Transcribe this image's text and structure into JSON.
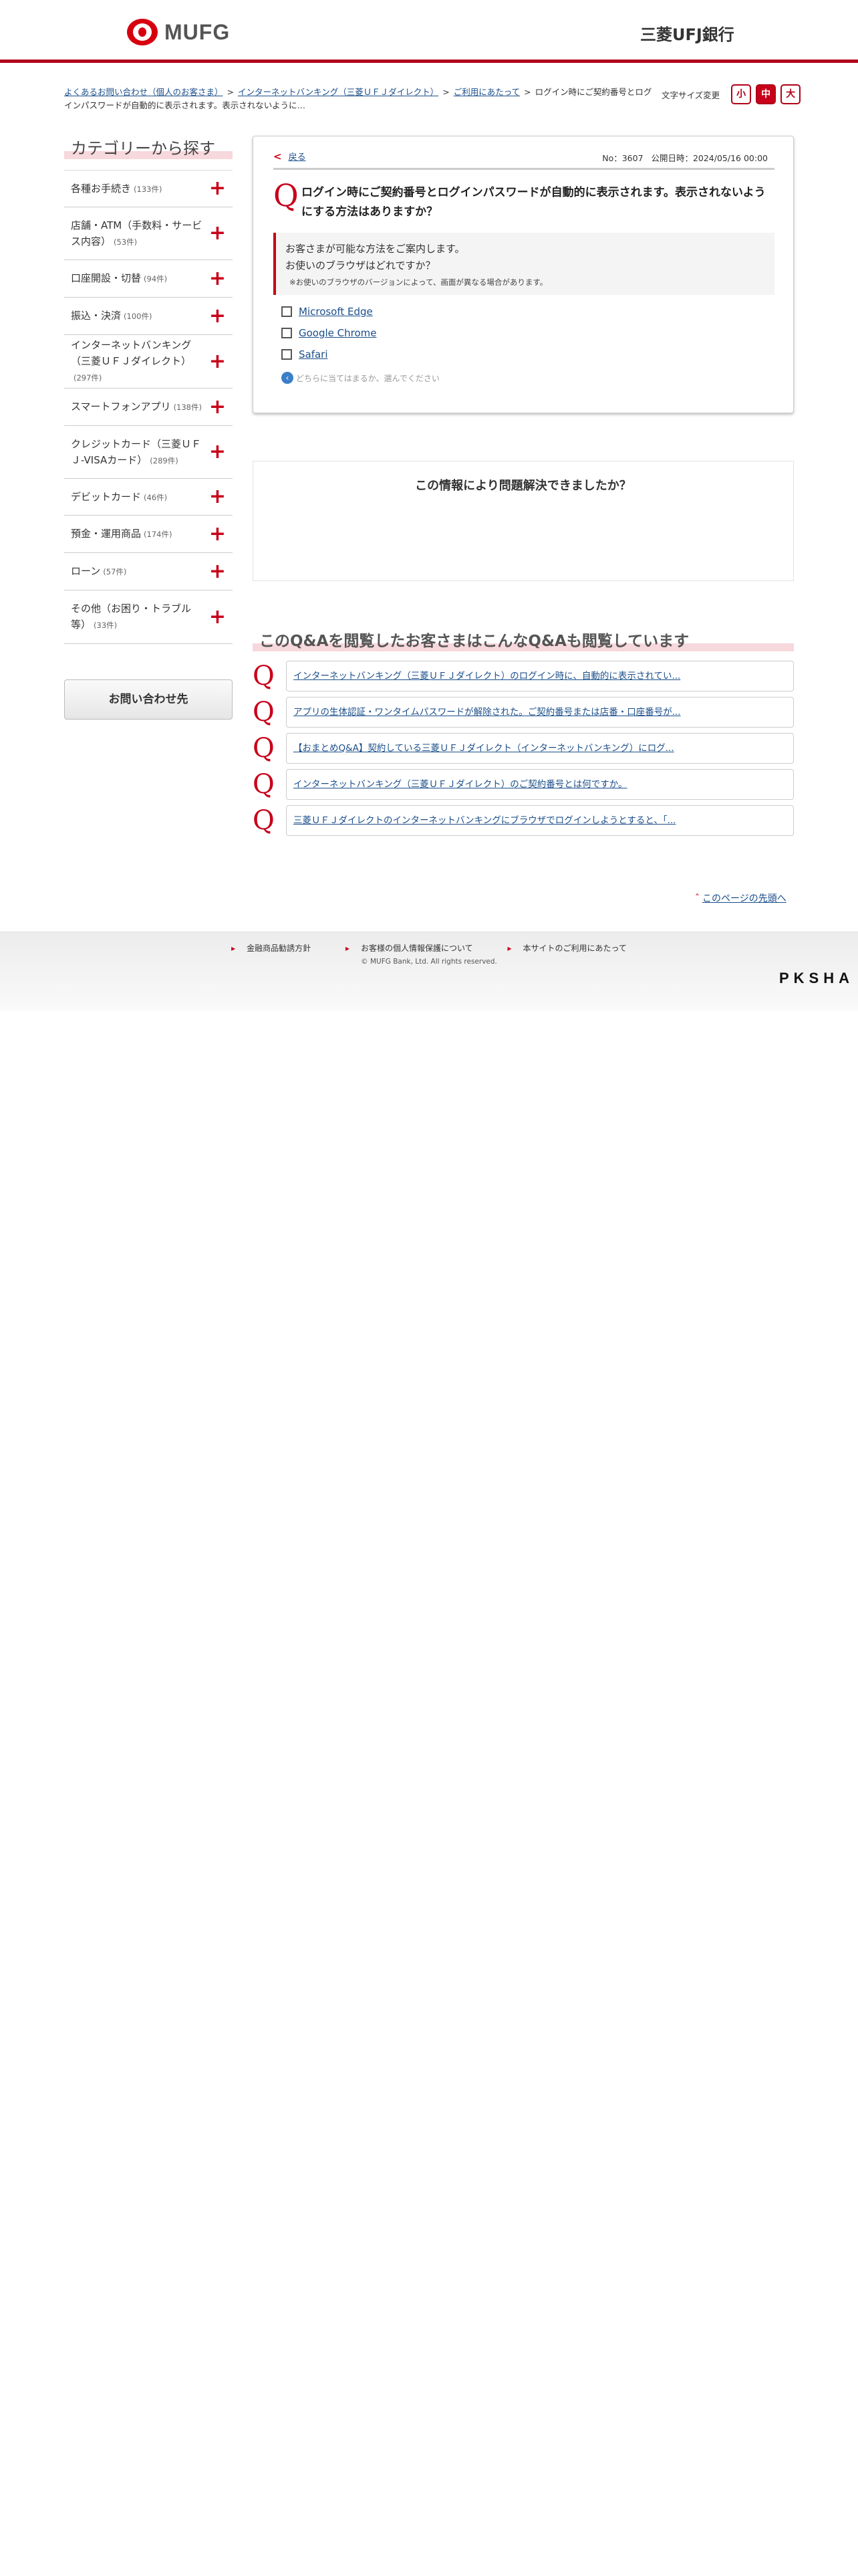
{
  "header": {
    "logo_text": "MUFG",
    "bank_name": "三菱UFJ銀行"
  },
  "breadcrumb": {
    "items": [
      "よくあるお問い合わせ（個人のお客さま）",
      "インターネットバンキング（三菱ＵＦＪダイレクト）",
      "ご利用にあたって"
    ],
    "current": "ログイン時にご契約番号とログインパスワードが自動的に表示されます。表示されないように…",
    "separator": ">"
  },
  "font_size_control": {
    "label": "文字サイズ変更",
    "small": "小",
    "medium": "中",
    "large": "大",
    "selected": "中"
  },
  "sidebar": {
    "title": "カテゴリーから探す",
    "items": [
      {
        "label": "各種お手続き",
        "count": "(133件)"
      },
      {
        "label": "店舗・ATM（手数料・サービス内容）",
        "count": "(53件)"
      },
      {
        "label": "口座開設・切替",
        "count": "(94件)"
      },
      {
        "label": "振込・決済",
        "count": "(100件)"
      },
      {
        "label": "インターネットバンキング（三菱ＵＦＪダイレクト）",
        "count": "(297件)"
      },
      {
        "label": "スマートフォンアプリ",
        "count": "(138件)"
      },
      {
        "label": "クレジットカード（三菱ＵＦＪ-VISAカード）",
        "count": "(289件)"
      },
      {
        "label": "デビットカード",
        "count": "(46件)"
      },
      {
        "label": "預金・運用商品",
        "count": "(174件)"
      },
      {
        "label": "ローン",
        "count": "(57件)"
      },
      {
        "label": "その他（お困り・トラブル等）",
        "count": "(33件)"
      }
    ],
    "contact_button": "お問い合わせ先"
  },
  "qa": {
    "back_label": "戻る",
    "number": "No：3607",
    "published": "公開日時：2024/05/16 00:00",
    "q_mark": "Q",
    "question": "ログイン時にご契約番号とログインパスワードが自動的に表示されます。表示されないようにする方法はありますか？",
    "answer_line1": "お客さまが可能な方法をご案内します。",
    "answer_line2": "お使いのブラウザはどれですか？",
    "answer_note": "※お使いのブラウザのバージョンによって、画面が異なる場合があります。",
    "choices": [
      "Microsoft Edge",
      "Google Chrome",
      "Safari"
    ],
    "hint": "どちらに当てはまるか、選んでください"
  },
  "feedback": {
    "title": "この情報により問題解決できましたか？"
  },
  "related": {
    "title": "このQ&Aを閲覧したお客さまはこんなQ&Aも閲覧しています",
    "q_mark": "Q",
    "items": [
      "インターネットバンキング（三菱ＵＦＪダイレクト）のログイン時に、自動的に表示されてい...",
      "アプリの生体認証・ワンタイムパスワードが解除された。ご契約番号または店番・口座番号が...",
      "【おまとめQ&A】契約している三菱ＵＦＪダイレクト（インターネットバンキング）にログ...",
      "インターネットバンキング（三菱ＵＦＪダイレクト）のご契約番号とは何ですか。",
      "三菱ＵＦＪダイレクトのインターネットバンキングにブラウザでログインしようとすると、「..."
    ]
  },
  "page_top": {
    "label": "このページの先頭へ"
  },
  "footer": {
    "links": [
      "金融商品勧誘方針",
      "お客様の個人情報保護について",
      "本サイトのご利用にあたって"
    ],
    "copyright": "© MUFG Bank, Ltd. All rights reserved.",
    "vendor_logo": "PKSHA"
  },
  "colors": {
    "brand_red": "#c8001a",
    "link_blue": "#1a4e8a",
    "title_bar_pink": "#f7d8dc"
  }
}
